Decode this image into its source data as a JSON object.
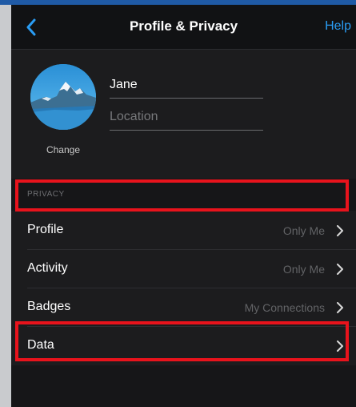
{
  "header": {
    "title": "Profile & Privacy",
    "help_label": "Help"
  },
  "profile": {
    "name": "Jane",
    "location_placeholder": "Location",
    "change_label": "Change"
  },
  "privacy": {
    "section_label": "PRIVACY",
    "items": [
      {
        "label": "Profile",
        "value": "Only Me"
      },
      {
        "label": "Activity",
        "value": "Only Me"
      },
      {
        "label": "Badges",
        "value": "My Connections"
      },
      {
        "label": "Data",
        "value": ""
      }
    ]
  },
  "colors": {
    "accent": "#2a9df4",
    "highlight": "#e8131c",
    "background": "#1c1c1e"
  }
}
